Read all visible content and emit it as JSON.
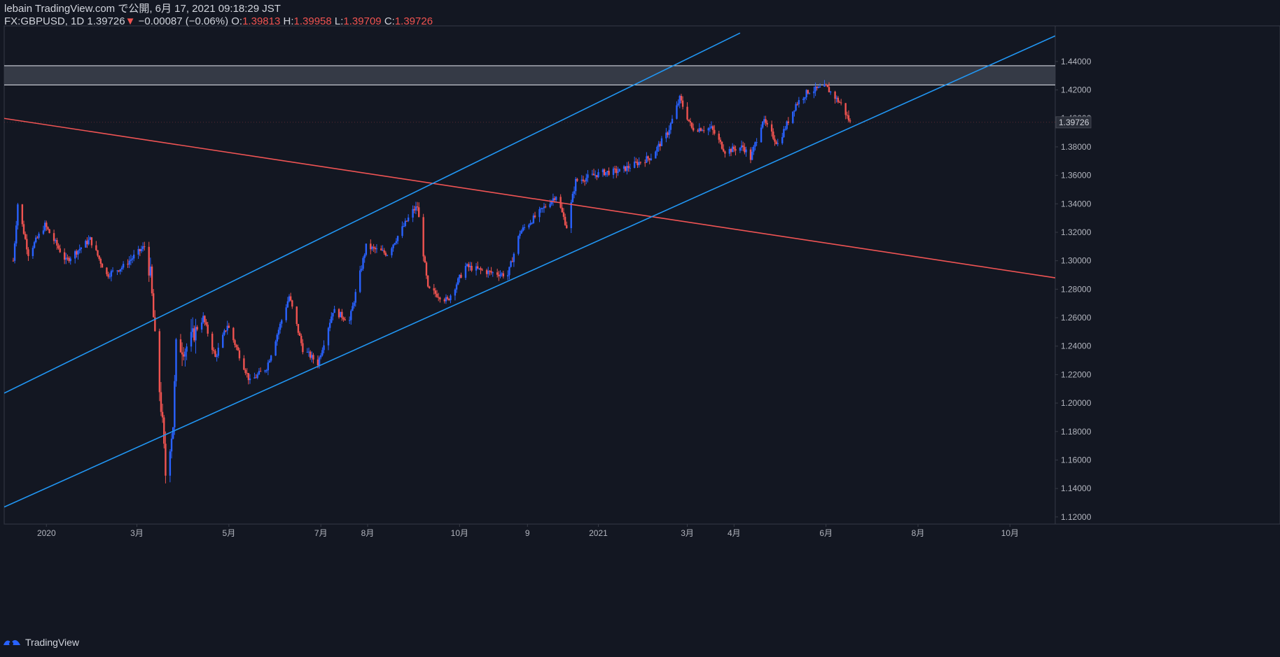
{
  "header": {
    "publisher": "lebain TradingView.com で公開, 6月 17, 2021 09:18:29 JST",
    "symbol": "FX:GBPUSD, 1D",
    "last": "1.39726",
    "change_arrow": "▼",
    "change": "−0.00087 (−0.06%)",
    "o_label": "O:",
    "o_value": "1.39813",
    "h_label": "H:",
    "h_value": "1.39958",
    "l_label": "L:",
    "l_value": "1.39709",
    "c_label": "C:",
    "c_value": "1.39726"
  },
  "footer": {
    "brand": "TradingView"
  },
  "colors": {
    "background": "#131722",
    "up": "#2962ff",
    "down": "#ef5350",
    "channel": "#2196f3",
    "trendline": "#f05454",
    "zone": "#3a3e4a",
    "axis_text": "#b2b5be"
  },
  "chart_data": {
    "type": "candlestick",
    "symbol": "GBPUSD",
    "interval": "1D",
    "ylim": [
      1.115,
      1.465
    ],
    "y_ticks": [
      "1.12000",
      "1.14000",
      "1.16000",
      "1.18000",
      "1.20000",
      "1.22000",
      "1.24000",
      "1.26000",
      "1.28000",
      "1.30000",
      "1.32000",
      "1.34000",
      "1.36000",
      "1.38000",
      "1.40000",
      "1.42000",
      "1.44000"
    ],
    "x_ticks": [
      "2020",
      "3月",
      "5月",
      "7月",
      "8月",
      "10月",
      "9",
      "2021",
      "3月",
      "4月",
      "6月",
      "8月",
      "10月"
    ],
    "last_price_label": "1.39726",
    "price_path": [
      [
        "2019-12-10",
        1.3
      ],
      [
        "2019-12-13",
        1.34
      ],
      [
        "2019-12-20",
        1.305
      ],
      [
        "2019-12-31",
        1.325
      ],
      [
        "2020-01-14",
        1.3
      ],
      [
        "2020-01-30",
        1.315
      ],
      [
        "2020-02-10",
        1.29
      ],
      [
        "2020-02-21",
        1.296
      ],
      [
        "2020-03-06",
        1.31
      ],
      [
        "2020-03-10",
        1.29
      ],
      [
        "2020-03-13",
        1.245
      ],
      [
        "2020-03-18",
        1.185
      ],
      [
        "2020-03-20",
        1.15
      ],
      [
        "2020-03-25",
        1.185
      ],
      [
        "2020-03-27",
        1.24
      ],
      [
        "2020-04-02",
        1.238
      ],
      [
        "2020-04-14",
        1.26
      ],
      [
        "2020-04-22",
        1.232
      ],
      [
        "2020-04-30",
        1.255
      ],
      [
        "2020-05-15",
        1.215
      ],
      [
        "2020-05-26",
        1.225
      ],
      [
        "2020-06-10",
        1.275
      ],
      [
        "2020-06-19",
        1.238
      ],
      [
        "2020-06-29",
        1.228
      ],
      [
        "2020-07-09",
        1.265
      ],
      [
        "2020-07-20",
        1.258
      ],
      [
        "2020-07-31",
        1.31
      ],
      [
        "2020-08-14",
        1.305
      ],
      [
        "2020-08-31",
        1.335
      ],
      [
        "2020-09-03",
        1.338
      ],
      [
        "2020-09-10",
        1.28
      ],
      [
        "2020-09-23",
        1.272
      ],
      [
        "2020-10-05",
        1.296
      ],
      [
        "2020-10-20",
        1.292
      ],
      [
        "2020-11-02",
        1.29
      ],
      [
        "2020-11-10",
        1.32
      ],
      [
        "2020-11-23",
        1.334
      ],
      [
        "2020-12-04",
        1.346
      ],
      [
        "2020-12-11",
        1.324
      ],
      [
        "2020-12-17",
        1.356
      ],
      [
        "2021-01-04",
        1.362
      ],
      [
        "2021-01-15",
        1.363
      ],
      [
        "2021-02-05",
        1.373
      ],
      [
        "2021-02-16",
        1.39
      ],
      [
        "2021-02-24",
        1.414
      ],
      [
        "2021-03-04",
        1.393
      ],
      [
        "2021-03-17",
        1.393
      ],
      [
        "2021-03-26",
        1.377
      ],
      [
        "2021-04-07",
        1.38
      ],
      [
        "2021-04-12",
        1.372
      ],
      [
        "2021-04-20",
        1.399
      ],
      [
        "2021-04-30",
        1.382
      ],
      [
        "2021-05-12",
        1.41
      ],
      [
        "2021-05-20",
        1.419
      ],
      [
        "2021-06-01",
        1.422
      ],
      [
        "2021-06-11",
        1.41
      ],
      [
        "2021-06-17",
        1.397
      ]
    ],
    "drawings": [
      {
        "kind": "trendline",
        "from": [
          "2019-12-04",
          1.4
        ],
        "to": [
          "2021-10-31",
          1.288
        ]
      },
      {
        "kind": "channel-upper",
        "from": [
          "2019-12-04",
          1.207
        ],
        "to": [
          "2021-04-05",
          1.46
        ]
      },
      {
        "kind": "channel-lower",
        "from": [
          "2019-12-04",
          1.127
        ],
        "to": [
          "2021-10-31",
          1.458
        ]
      },
      {
        "kind": "resistance-zone",
        "y": [
          1.4235,
          1.437
        ]
      }
    ]
  }
}
